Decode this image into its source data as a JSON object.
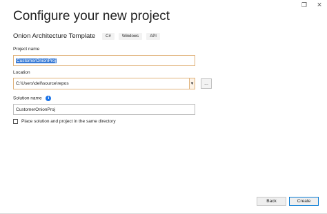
{
  "window": {
    "controls": {
      "restore_glyph": "❐",
      "close_glyph": "✕"
    }
  },
  "header": {
    "title": "Configure your new project"
  },
  "template": {
    "name": "Onion Architecture Template",
    "tags": [
      "C#",
      "Windows",
      "API"
    ]
  },
  "project_name": {
    "label": "Project name",
    "value": "CustomerOnionProj"
  },
  "location": {
    "label": "Location",
    "value": "C:\\Users\\dell\\source\\repos",
    "browse_label": "..."
  },
  "solution_name": {
    "label": "Solution name",
    "info_glyph": "i",
    "value": "CustomerOnionProj"
  },
  "options": {
    "same_directory_label": "Place solution and project in the same directory",
    "same_directory_checked": false
  },
  "footer": {
    "back_label": "Back",
    "create_label": "Create"
  },
  "colors": {
    "accent": "#0078d4",
    "focus_border": "#e0b27a",
    "selection": "#3a7bd5",
    "info": "#1a73e8"
  }
}
